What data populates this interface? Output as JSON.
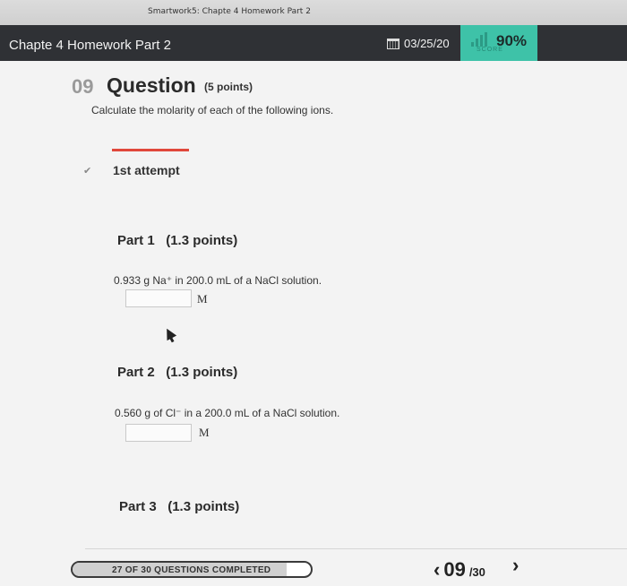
{
  "browser": {
    "title": "Smartwork5: Chapte 4 Homework Part 2"
  },
  "header": {
    "title": "Chapte 4 Homework Part 2",
    "due_date": "03/25/20",
    "score": "90%",
    "score_label": "SCORE",
    "colors": {
      "bar": "#2f3135",
      "score_bg": "#3ec2a8"
    }
  },
  "question": {
    "number": "09",
    "title": "Question",
    "points": "(5 points)",
    "prompt": "Calculate the molarity of each of the following ions.",
    "attempt": "1st attempt"
  },
  "parts": [
    {
      "title": "Part 1",
      "points": "(1.3 points)",
      "prompt": "0.933 g Na⁺ in 200.0 mL of a NaCl solution.",
      "answer": "",
      "unit": "M"
    },
    {
      "title": "Part 2",
      "points": "(1.3 points)",
      "prompt": "0.560 g of Cl⁻ in a 200.0 mL of a NaCl solution.",
      "answer": "",
      "unit": "M"
    },
    {
      "title": "Part 3",
      "points": "(1.3 points)"
    }
  ],
  "footer": {
    "progress_text": "27 OF 30 QUESTIONS COMPLETED",
    "progress_fraction": 0.9,
    "current": "09",
    "total": "/30",
    "prev_icon": "chevron-left-icon",
    "next_icon": "chevron-right-icon"
  }
}
